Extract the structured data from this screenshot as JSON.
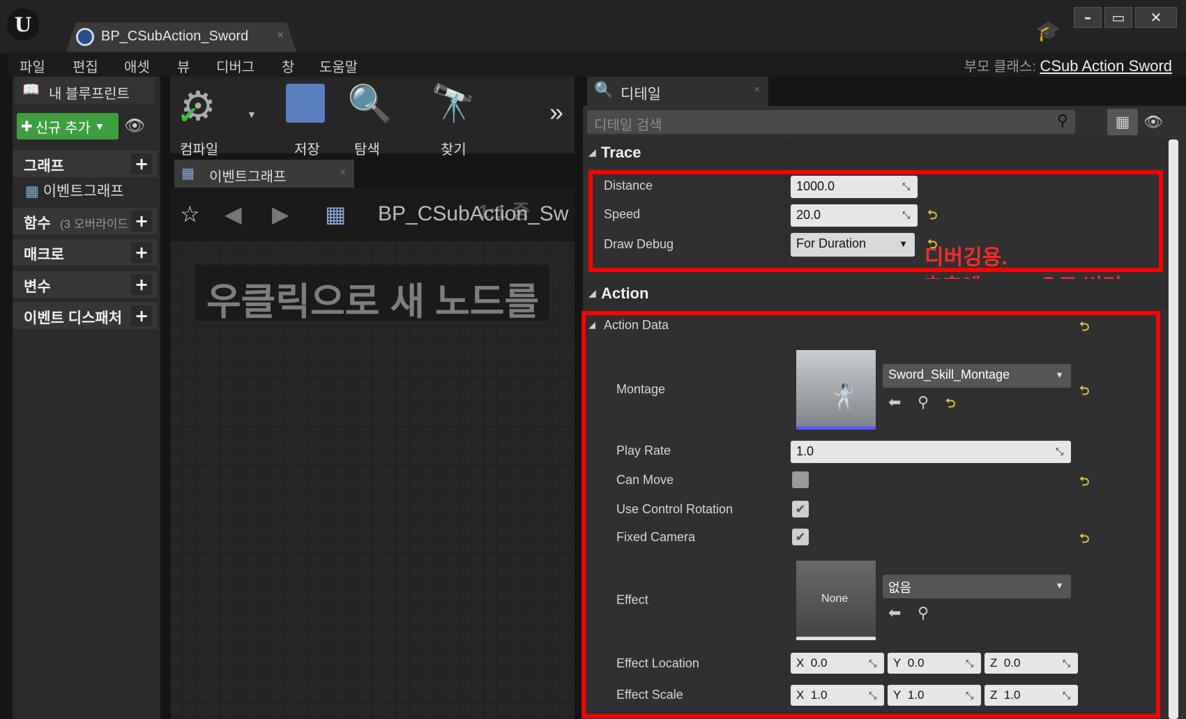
{
  "window": {
    "logo": "U",
    "tab_title": "BP_CSubAction_Sword",
    "tab_close": "×"
  },
  "menu": [
    "파일",
    "편집",
    "애셋",
    "뷰",
    "디버그",
    "창",
    "도움말"
  ],
  "parent_class": {
    "label": "부모 클래스:",
    "value": "CSub Action Sword"
  },
  "left_panel": {
    "tab_title": "내 블루프린트",
    "add_new": "신규 추가",
    "sections": [
      {
        "label": "그래프"
      },
      {
        "label": "함수",
        "note": "(3 오버라이드"
      },
      {
        "label": "매크로"
      },
      {
        "label": "변수"
      },
      {
        "label": "이벤트 디스패처"
      }
    ],
    "graph_item": "이벤트그래프"
  },
  "toolbar": {
    "compile": "컴파일",
    "save": "저장",
    "browse": "탐색",
    "find": "찾기",
    "more": "»"
  },
  "graph": {
    "tab": "이벤트그래프",
    "breadcrumb": "BP_CSubAction_Sw",
    "zoom": "1:1 중",
    "hint": "우클릭으로 새 노드를"
  },
  "details": {
    "tab": "디테일",
    "search_placeholder": "디테일 검색",
    "trace": {
      "title": "Trace",
      "distance_label": "Distance",
      "distance": "1000.0",
      "speed_label": "Speed",
      "speed": "20.0",
      "draw_debug_label": "Draw Debug",
      "draw_debug": "For Duration"
    },
    "action": {
      "title": "Action",
      "data_title": "Action Data",
      "montage_label": "Montage",
      "montage": "Sword_Skill_Montage",
      "play_rate_label": "Play Rate",
      "play_rate": "1.0",
      "can_move_label": "Can Move",
      "use_control_rotation_label": "Use Control Rotation",
      "fixed_camera_label": "Fixed Camera",
      "effect_label": "Effect",
      "effect": "없음",
      "effect_thumb": "None",
      "effect_location_label": "Effect Location",
      "effect_location": {
        "x": "0.0",
        "y": "0.0",
        "z": "0.0"
      },
      "effect_scale_label": "Effect Scale",
      "effect_scale": {
        "x": "1.0",
        "y": "1.0",
        "z": "1.0"
      }
    },
    "checks": {
      "can_move": false,
      "use_control_rotation": true,
      "fixed_camera": true
    }
  },
  "annotation": {
    "line1": "디버깅용.",
    "line2": "추후에 None으로 변경."
  },
  "colors": {
    "annotation_red": "#ff0000",
    "reset_yellow": "#d6c43a",
    "add_green": "#3f9e3f"
  }
}
